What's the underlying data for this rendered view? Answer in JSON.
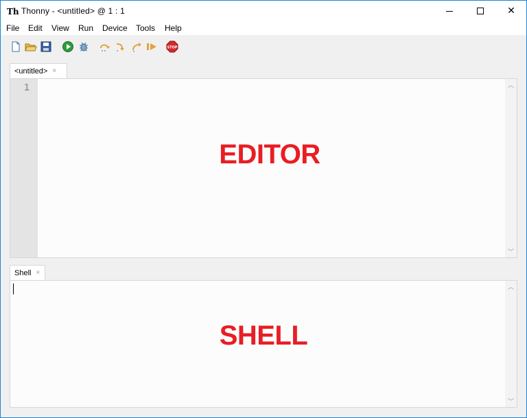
{
  "window": {
    "title": "Thonny  -  <untitled>  @  1 : 1",
    "app_icon": "Th",
    "controls": {
      "minimize": "minimize-icon",
      "maximize": "maximize-icon",
      "close": "✕"
    }
  },
  "menu": [
    {
      "label": "File"
    },
    {
      "label": "Edit"
    },
    {
      "label": "View"
    },
    {
      "label": "Run"
    },
    {
      "label": "Device"
    },
    {
      "label": "Tools"
    },
    {
      "label": "Help"
    }
  ],
  "toolbar": [
    {
      "name": "new-file",
      "icon": "new-file-icon"
    },
    {
      "name": "open-file",
      "icon": "open-folder-icon"
    },
    {
      "name": "save-file",
      "icon": "save-icon"
    },
    {
      "name": "run",
      "icon": "run-icon"
    },
    {
      "name": "debug",
      "icon": "debug-icon"
    },
    {
      "name": "step-over",
      "icon": "step-over-icon"
    },
    {
      "name": "step-into",
      "icon": "step-into-icon"
    },
    {
      "name": "step-out",
      "icon": "step-out-icon"
    },
    {
      "name": "resume",
      "icon": "resume-icon"
    },
    {
      "name": "stop",
      "icon": "stop-icon",
      "label": "STOP"
    }
  ],
  "editor": {
    "tab_label": "<untitled>",
    "tab_close": "×",
    "line_numbers": [
      "1"
    ],
    "overlay_label": "EDITOR"
  },
  "shell": {
    "tab_label": "Shell",
    "tab_close": "×",
    "overlay_label": "SHELL"
  },
  "scroll": {
    "up": "︿",
    "down": "﹀"
  },
  "colors": {
    "overlay": "#e81e24",
    "window_border": "#1883d7",
    "gutter": "#e4e4e4"
  }
}
